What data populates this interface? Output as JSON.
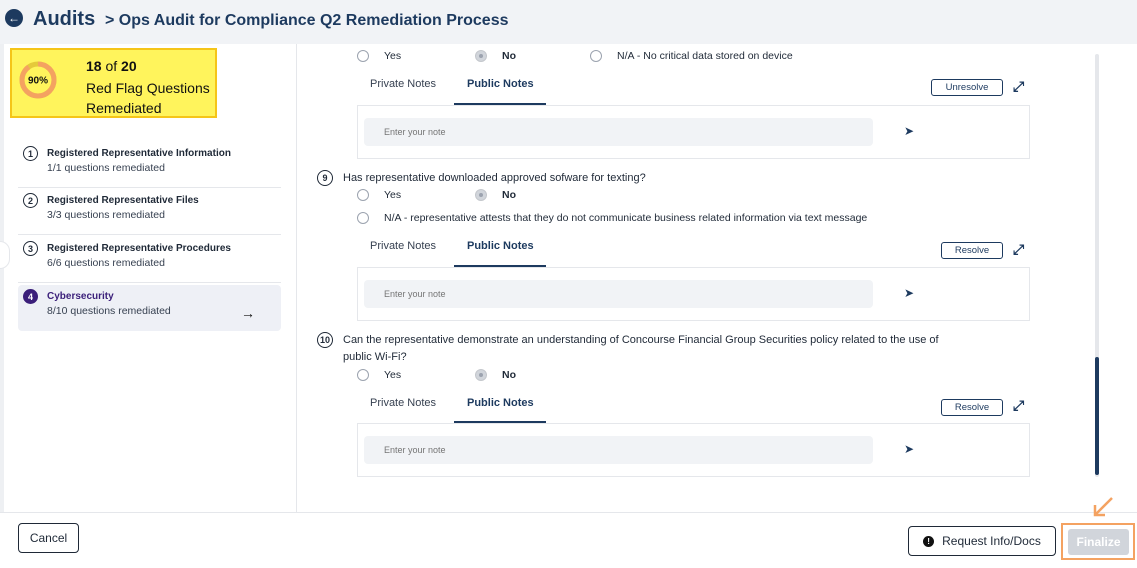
{
  "header": {
    "back_icon": "arrow-left-circle-icon",
    "title": "Audits",
    "subtitle": "> Ops Audit for Compliance Q2 Remediation Process"
  },
  "progress": {
    "percent_label": "90%",
    "percent": 90,
    "done": "18",
    "of": "of",
    "total": "20",
    "label": "Red Flag Questions Remediated",
    "ring_color": "#f4a261",
    "highlight_color": "#fff45c"
  },
  "steps": [
    {
      "num": "1",
      "title": "Registered Representative Information",
      "sub": "1/1 questions remediated"
    },
    {
      "num": "2",
      "title": "Registered Representative Files",
      "sub": "3/3 questions remediated"
    },
    {
      "num": "3",
      "title": "Registered Representative Procedures",
      "sub": "6/6 questions remediated"
    },
    {
      "num": "4",
      "title": "Cybersecurity",
      "sub": "8/10 questions remediated",
      "active": true
    }
  ],
  "questions": {
    "q8": {
      "opt_yes": "Yes",
      "opt_no": "No",
      "opt_na": "N/A - No critical data stored on device",
      "tab_private": "Private Notes",
      "tab_public": "Public Notes",
      "action": "Unresolve",
      "note_placeholder": "Enter your note"
    },
    "q9": {
      "num": "9",
      "text": "Has representative downloaded approved sofware for texting?",
      "opt_yes": "Yes",
      "opt_no": "No",
      "opt_na": "N/A - representative attests that they do not communicate business related information via text message",
      "tab_private": "Private Notes",
      "tab_public": "Public Notes",
      "action": "Resolve",
      "note_placeholder": "Enter your note"
    },
    "q10": {
      "num": "10",
      "text_line1": "Can the representative demonstrate an understanding of Concourse Financial Group Securities policy related to the use of",
      "text_line2": "public Wi-Fi?",
      "opt_yes": "Yes",
      "opt_no": "No",
      "tab_private": "Private Notes",
      "tab_public": "Public Notes",
      "action": "Resolve",
      "note_placeholder": "Enter your note"
    }
  },
  "footer": {
    "cancel": "Cancel",
    "request": "Request Info/Docs",
    "finalize": "Finalize"
  },
  "colors": {
    "primary": "#1d3a5f",
    "active_step": "#3b1f7a",
    "highlight_outline": "#f4a261"
  }
}
